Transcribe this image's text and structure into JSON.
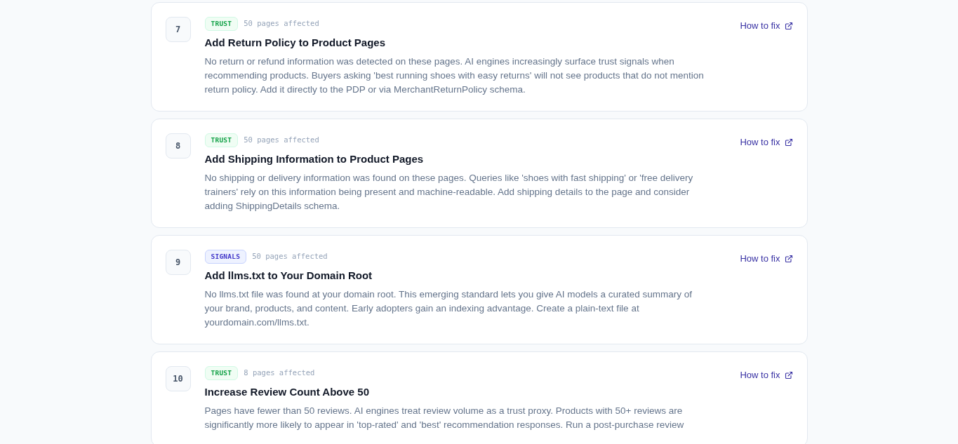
{
  "issues": [
    {
      "number": "7",
      "category": {
        "label": "TRUST",
        "kind": "trust"
      },
      "pages": "50 pages affected",
      "title": "Add Return Policy to Product Pages",
      "description": "No return or refund information was detected on these pages. AI engines increasingly surface trust signals when recommending products. Buyers asking 'best running shoes with easy returns' will not see products that do not mention return policy. Add it directly to the PDP or via MerchantReturnPolicy schema.",
      "link": "How to fix"
    },
    {
      "number": "8",
      "category": {
        "label": "TRUST",
        "kind": "trust"
      },
      "pages": "50 pages affected",
      "title": "Add Shipping Information to Product Pages",
      "description": "No shipping or delivery information was found on these pages. Queries like 'shoes with fast shipping' or 'free delivery trainers' rely on this information being present and machine-readable. Add shipping details to the page and consider adding ShippingDetails schema.",
      "link": "How to fix"
    },
    {
      "number": "9",
      "category": {
        "label": "SIGNALS",
        "kind": "signals"
      },
      "pages": "50 pages affected",
      "title": "Add llms.txt to Your Domain Root",
      "description": "No llms.txt file was found at your domain root. This emerging standard lets you give AI models a curated summary of your brand, products, and content. Early adopters gain an indexing advantage. Create a plain-text file at yourdomain.com/llms.txt.",
      "link": "How to fix"
    },
    {
      "number": "10",
      "category": {
        "label": "TRUST",
        "kind": "trust"
      },
      "pages": "8 pages affected",
      "title": "Increase Review Count Above 50",
      "description": "Pages have fewer than 50 reviews. AI engines treat review volume as a trust proxy. Products with 50+ reviews are significantly more likely to appear in 'top-rated' and 'best' recommendation responses. Run a post-purchase review",
      "link": "How to fix"
    }
  ]
}
